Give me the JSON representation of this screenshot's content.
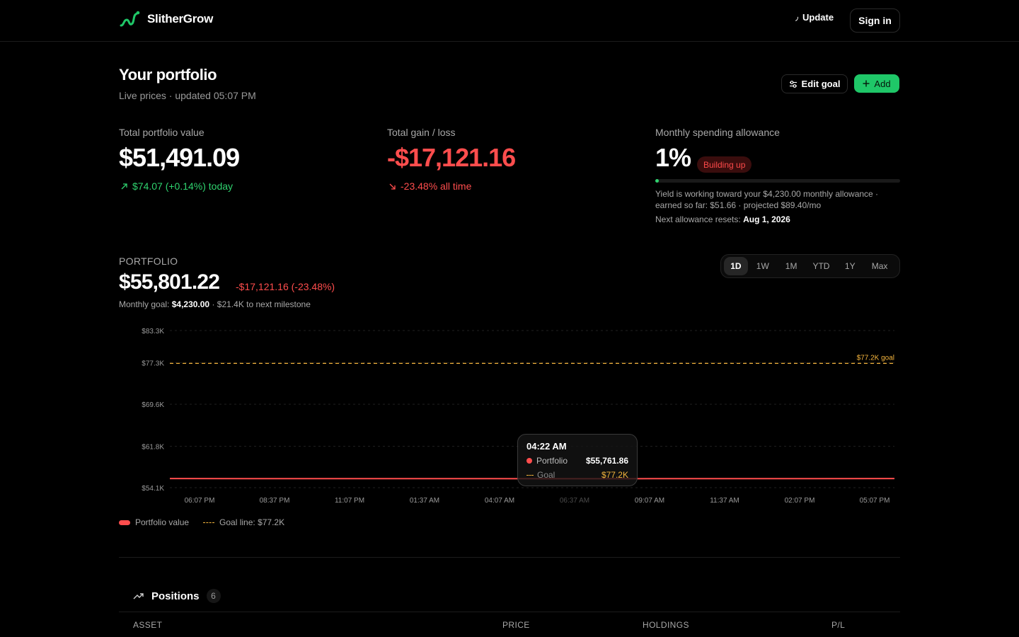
{
  "app": {
    "name": "SlitherGrow"
  },
  "header": {
    "update_label": "Update",
    "signin_label": "Sign in"
  },
  "page": {
    "title": "Your portfolio",
    "subtitle": "Live prices · updated 05:07 PM",
    "edit_goal_label": "Edit goal",
    "add_label": "Add"
  },
  "stats": {
    "total": {
      "label": "Total portfolio value",
      "value": "$51,491.09",
      "change": "$74.07 (+0.14%) today"
    },
    "gain": {
      "label": "Total gain / loss",
      "value": "-$17,121.16",
      "change": "-23.48% all time"
    },
    "allowance": {
      "label": "Monthly spending allowance",
      "value": "1%",
      "badge": "Building up",
      "progress_pct": 1,
      "note1": "Yield is working toward your $4,230.00 monthly allowance ·",
      "note2": "earned so far: $51.66 · projected $89.40/mo",
      "reset_label": "Next allowance resets:",
      "reset_date": "Aug 1, 2026"
    }
  },
  "portfolio": {
    "label": "PORTFOLIO",
    "value": "$55,801.22",
    "change": "-$17,121.16 (-23.48%)",
    "goal_prefix": "Monthly goal:",
    "goal_value": "$4,230.00",
    "goal_suffix": "· $21.4K to next milestone",
    "ranges": [
      "1D",
      "1W",
      "1M",
      "YTD",
      "1Y",
      "Max"
    ],
    "active_range": "1D"
  },
  "tooltip": {
    "time": "04:22 AM",
    "portfolio_label": "Portfolio",
    "portfolio_value": "$55,761.86",
    "goal_label": "Goal",
    "goal_value": "$77.2K"
  },
  "legend": {
    "portfolio": "Portfolio value",
    "goal": "Goal line: $77.2K"
  },
  "positions": {
    "title": "Positions",
    "count": "6",
    "columns": {
      "asset": "ASSET",
      "price": "PRICE",
      "holdings": "HOLDINGS",
      "pl": "P/L"
    }
  },
  "colors": {
    "accent": "#1fc768",
    "loss": "#ff4d4d",
    "goal": "#f5b53d",
    "background": "#000000"
  },
  "chart_data": {
    "type": "line",
    "y_ticks": [
      {
        "value": 83300,
        "label": "$83.3K"
      },
      {
        "value": 77300,
        "label": "$77.3K"
      },
      {
        "value": 69600,
        "label": "$69.6K"
      },
      {
        "value": 61800,
        "label": "$61.8K"
      },
      {
        "value": 54100,
        "label": "$54.1K"
      }
    ],
    "ylim": [
      54100,
      83300
    ],
    "x_ticks": [
      "06:07 PM",
      "08:37 PM",
      "11:07 PM",
      "01:37 AM",
      "04:07 AM",
      "06:37 AM",
      "09:07 AM",
      "11:37 AM",
      "02:07 PM",
      "05:07 PM"
    ],
    "x_tick_dimmed_index": 5,
    "series": [
      {
        "name": "Portfolio value",
        "color": "#ff4d4d",
        "values": [
          55800,
          55790,
          55780,
          55770,
          55765,
          55762,
          55770,
          55780,
          55790,
          55801
        ]
      }
    ],
    "goal": {
      "value": 77200,
      "label": "$77.2K goal",
      "color": "#f5b53d"
    },
    "grid": true
  }
}
